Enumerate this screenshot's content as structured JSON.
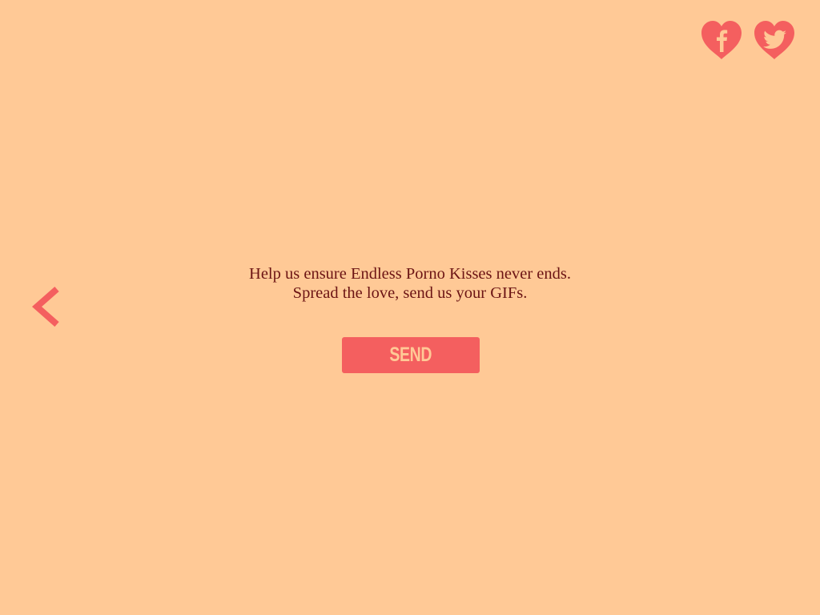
{
  "colors": {
    "background": "#ffc996",
    "accent": "#f45f5f",
    "text": "#6b1414"
  },
  "social": {
    "facebook": {
      "icon": "facebook-heart-icon"
    },
    "twitter": {
      "icon": "twitter-heart-icon"
    }
  },
  "nav": {
    "back_icon": "chevron-left-icon"
  },
  "message": {
    "line1": "Help us ensure Endless Porno Kisses never ends.",
    "line2": "Spread the love, send us your GIFs."
  },
  "send_button": {
    "label": "SEND"
  }
}
